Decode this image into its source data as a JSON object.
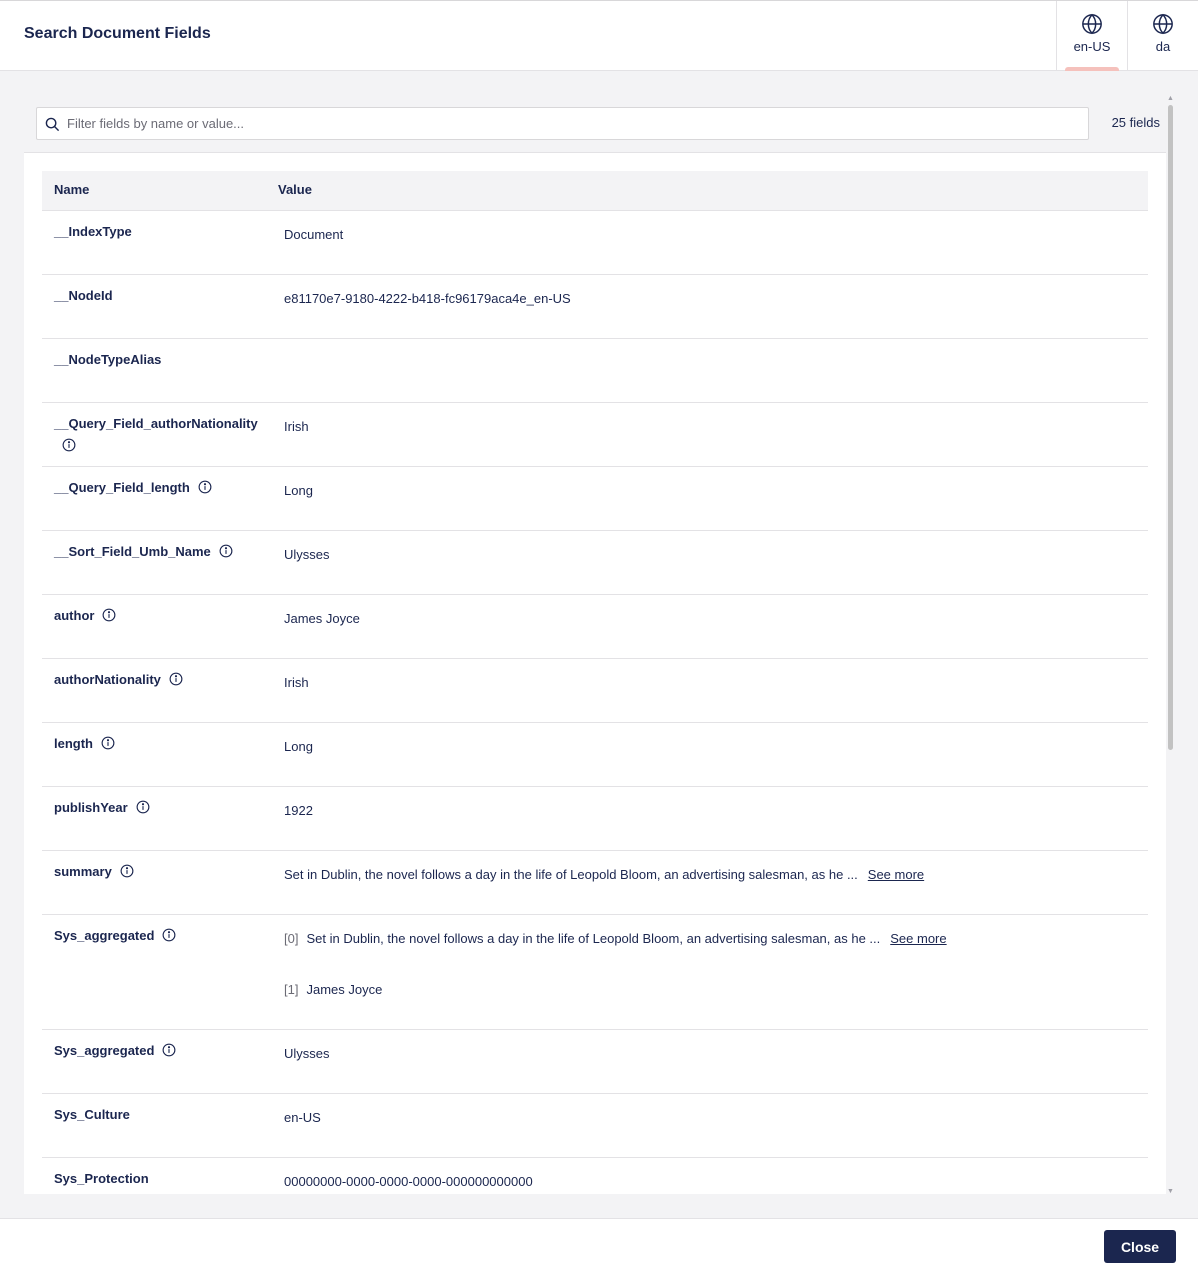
{
  "header": {
    "title": "Search Document Fields",
    "languages": [
      {
        "label": "en-US",
        "active": true
      },
      {
        "label": "da",
        "active": false
      }
    ]
  },
  "filter": {
    "placeholder": "Filter fields by name or value...",
    "value": "",
    "count": "25 fields"
  },
  "table": {
    "columns": {
      "name": "Name",
      "value": "Value"
    },
    "rows": [
      {
        "name": "__IndexType",
        "info": false,
        "value": "Document"
      },
      {
        "name": "__NodeId",
        "info": false,
        "value": "e81170e7-9180-4222-b418-fc96179aca4e_en-US"
      },
      {
        "name": "__NodeTypeAlias",
        "info": false,
        "value": ""
      },
      {
        "name": "__Query_Field_authorNationality",
        "info": true,
        "value": "Irish"
      },
      {
        "name": "__Query_Field_length",
        "info": true,
        "value": "Long"
      },
      {
        "name": "__Sort_Field_Umb_Name",
        "info": true,
        "value": "Ulysses"
      },
      {
        "name": "author",
        "info": true,
        "value": "James Joyce"
      },
      {
        "name": "authorNationality",
        "info": true,
        "value": "Irish"
      },
      {
        "name": "length",
        "info": true,
        "value": "Long"
      },
      {
        "name": "publishYear",
        "info": true,
        "value": "1922"
      },
      {
        "name": "summary",
        "info": true,
        "value": "Set in Dublin, the novel follows a day in the life of Leopold Bloom, an advertising salesman, as he ...",
        "see_more": "See more"
      },
      {
        "name": "Sys_aggregated",
        "info": true,
        "multi": true,
        "values": [
          {
            "index": "[0]",
            "value": "Set in Dublin, the novel follows a day in the life of Leopold Bloom, an advertising salesman, as he ...",
            "see_more": "See more"
          },
          {
            "index": "[1]",
            "value": "James Joyce"
          }
        ]
      },
      {
        "name": "Sys_aggregated",
        "info": true,
        "value": "Ulysses"
      },
      {
        "name": "Sys_Culture",
        "info": false,
        "value": "en-US"
      },
      {
        "name": "Sys_Protection",
        "info": false,
        "value": "00000000-0000-0000-0000-000000000000"
      }
    ]
  },
  "footer": {
    "close_label": "Close"
  },
  "colors": {
    "primary": "#1b264f",
    "active_tab_indicator": "#f5c1bc",
    "background": "#f3f3f5"
  }
}
